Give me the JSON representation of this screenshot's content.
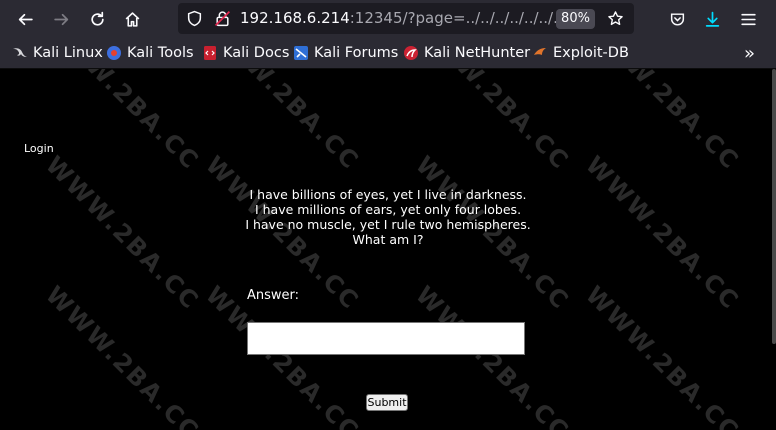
{
  "browser": {
    "url_host": "192.168.6.214",
    "url_rest": ":12345/?page=../../../../../../../..",
    "zoom": "80%"
  },
  "bookmarks": [
    {
      "label": "Kali Linux",
      "icon": "kali-dragon-icon"
    },
    {
      "label": "Kali Tools",
      "icon": "kali-tools-icon"
    },
    {
      "label": "Kali Docs",
      "icon": "kali-docs-icon"
    },
    {
      "label": "Kali Forums",
      "icon": "kali-forums-icon"
    },
    {
      "label": "Kali NetHunter",
      "icon": "nethunter-icon"
    },
    {
      "label": "Exploit-DB",
      "icon": "exploit-db-icon"
    }
  ],
  "page": {
    "login_link": "Login",
    "riddle_lines": [
      "I have billions of eyes, yet I live in darkness.",
      "I have millions of ears, yet only four lobes.",
      "I have no muscle, yet I rule two hemispheres.",
      "What am I?"
    ],
    "answer_label": "Answer:",
    "answer_value": "",
    "submit_label": "Submit",
    "watermark": "WWW.2BA.CC"
  },
  "colors": {
    "chrome_bg": "#2b2a33",
    "urlbar_bg": "#1c1b22",
    "download_accent": "#0df",
    "page_bg": "#000000"
  }
}
